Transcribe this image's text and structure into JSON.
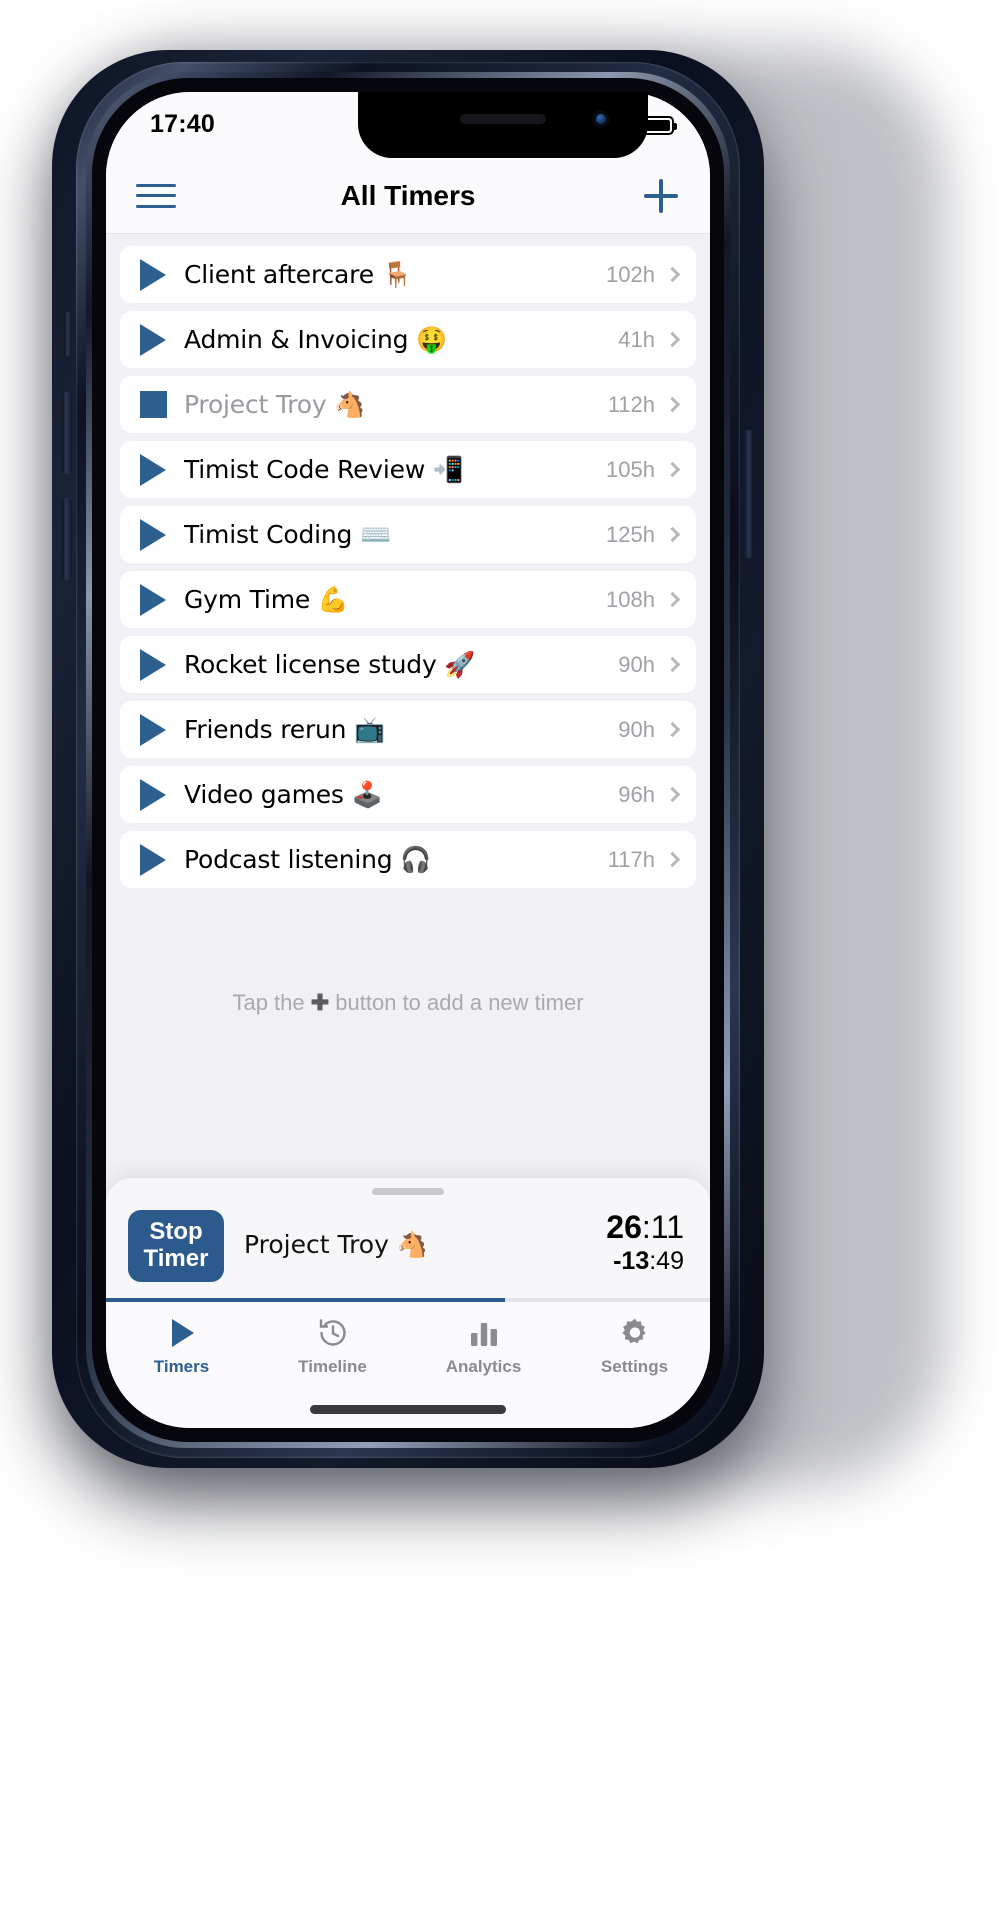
{
  "status_bar": {
    "time": "17:40",
    "signal_icon": "signal-dots-icon",
    "wifi_icon": "wifi-icon",
    "battery_icon": "battery-full-icon"
  },
  "nav_bar": {
    "menu_icon": "hamburger-menu-icon",
    "title": "All Timers",
    "add_icon": "plus-icon"
  },
  "timers": [
    {
      "control": "play",
      "label": "Client aftercare 🪑",
      "duration": "102h",
      "running": false
    },
    {
      "control": "play",
      "label": "Admin & Invoicing 🤑",
      "duration": "41h",
      "running": false
    },
    {
      "control": "stop",
      "label": "Project Troy 🐴",
      "duration": "112h",
      "running": true
    },
    {
      "control": "play",
      "label": "Timist Code Review 📲",
      "duration": "105h",
      "running": false
    },
    {
      "control": "play",
      "label": "Timist Coding ⌨️",
      "duration": "125h",
      "running": false
    },
    {
      "control": "play",
      "label": "Gym Time 💪",
      "duration": "108h",
      "running": false
    },
    {
      "control": "play",
      "label": "Rocket license study 🚀",
      "duration": "90h",
      "running": false
    },
    {
      "control": "play",
      "label": "Friends rerun 📺",
      "duration": "90h",
      "running": false
    },
    {
      "control": "play",
      "label": "Video games 🕹️",
      "duration": "96h",
      "running": false
    },
    {
      "control": "play",
      "label": "Podcast listening 🎧",
      "duration": "117h",
      "running": false
    }
  ],
  "hint": {
    "prefix": "Tap the ",
    "icon": "✚",
    "suffix": " button to add a new timer"
  },
  "running_timer": {
    "stop_line1": "Stop",
    "stop_line2": "Timer",
    "name": "Project Troy 🐴",
    "elapsed_major": "26",
    "elapsed_minor": ":11",
    "remaining_major": "-13",
    "remaining_minor": ":49",
    "progress_percent": 66
  },
  "tab_bar": [
    {
      "icon": "play-triangle-icon",
      "label": "Timers",
      "active": true
    },
    {
      "icon": "clock-history-icon",
      "label": "Timeline",
      "active": false
    },
    {
      "icon": "bar-chart-icon",
      "label": "Analytics",
      "active": false
    },
    {
      "icon": "gear-icon",
      "label": "Settings",
      "active": false
    }
  ],
  "colors": {
    "accent": "#2d5f8f",
    "accent_dark": "#2d5a8c",
    "list_background": "#f0f0f5",
    "card_background": "#ffffff",
    "muted_text": "#a0a0a6"
  }
}
